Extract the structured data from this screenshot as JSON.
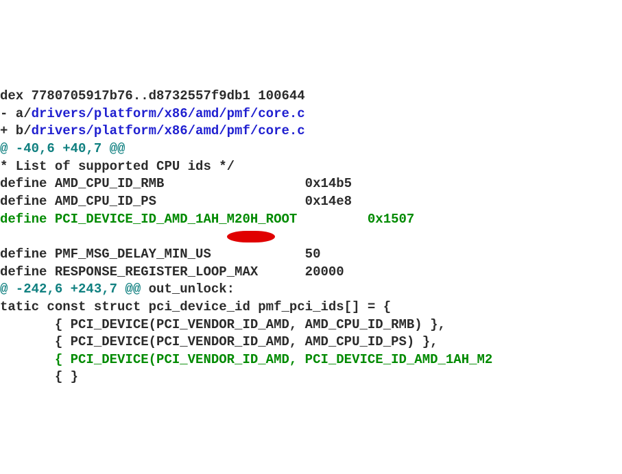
{
  "diff": {
    "index_line": "dex 7780705917b76..d8732557f9db1 100644",
    "minus_a_prefix": "- a/",
    "plus_b_prefix": "+ b/",
    "file_path": "drivers/platform/x86/amd/pmf/core.c",
    "hunk1_header": "@ -40,6 +40,7 @@",
    "context_cpu_ids": "* List of supported CPU ids */",
    "def_rmb": "define AMD_CPU_ID_RMB                  0x14b5",
    "def_ps": "define AMD_CPU_ID_PS                   0x14e8",
    "def_new_a": "define PCI_DEVICE_ID_AMD_1AH_M20H_ROOT",
    "def_new_val": "0x1507",
    "def_delay": "define PMF_MSG_DELAY_MIN_US            50",
    "def_loop": "define RESPONSE_REGISTER_LOOP_MAX      20000",
    "hunk2_header": "@ -242,6 +243,7 @@",
    "hunk2_func": " out_unlock:",
    "static_line": "tatic const struct pci_device_id pmf_pci_ids[] = {",
    "arr_rmb": "       { PCI_DEVICE(PCI_VENDOR_ID_AMD, AMD_CPU_ID_RMB) },",
    "arr_ps": "       { PCI_DEVICE(PCI_VENDOR_ID_AMD, AMD_CPU_ID_PS) },",
    "arr_new": "       { PCI_DEVICE(PCI_VENDOR_ID_AMD, PCI_DEVICE_ID_AMD_1AH_M2",
    "arr_end": "       { }"
  }
}
